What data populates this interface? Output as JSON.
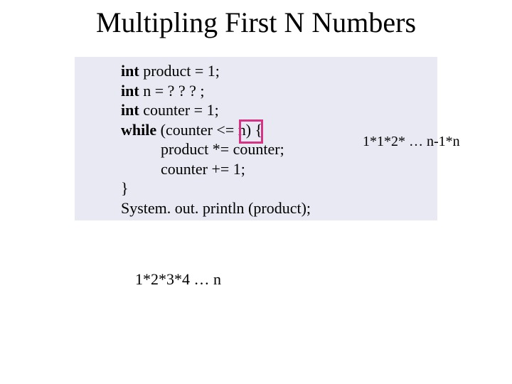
{
  "title": "Multipling First N Numbers",
  "code": {
    "l1a": "int",
    "l1b": " product = 1;",
    "l2a": "int",
    "l2b": " n = ? ? ? ;",
    "l3a": "int",
    "l3b": " counter = 1;",
    "l4a": "while",
    "l4b": " (counter <= n) {",
    "l5": "product *= counter;",
    "l6": "counter += 1;",
    "l7": "}",
    "l8": "System. out. println (product);"
  },
  "annotations": {
    "right": "1*1*2* … n-1*n",
    "bottom": "1*2*3*4 … n"
  }
}
